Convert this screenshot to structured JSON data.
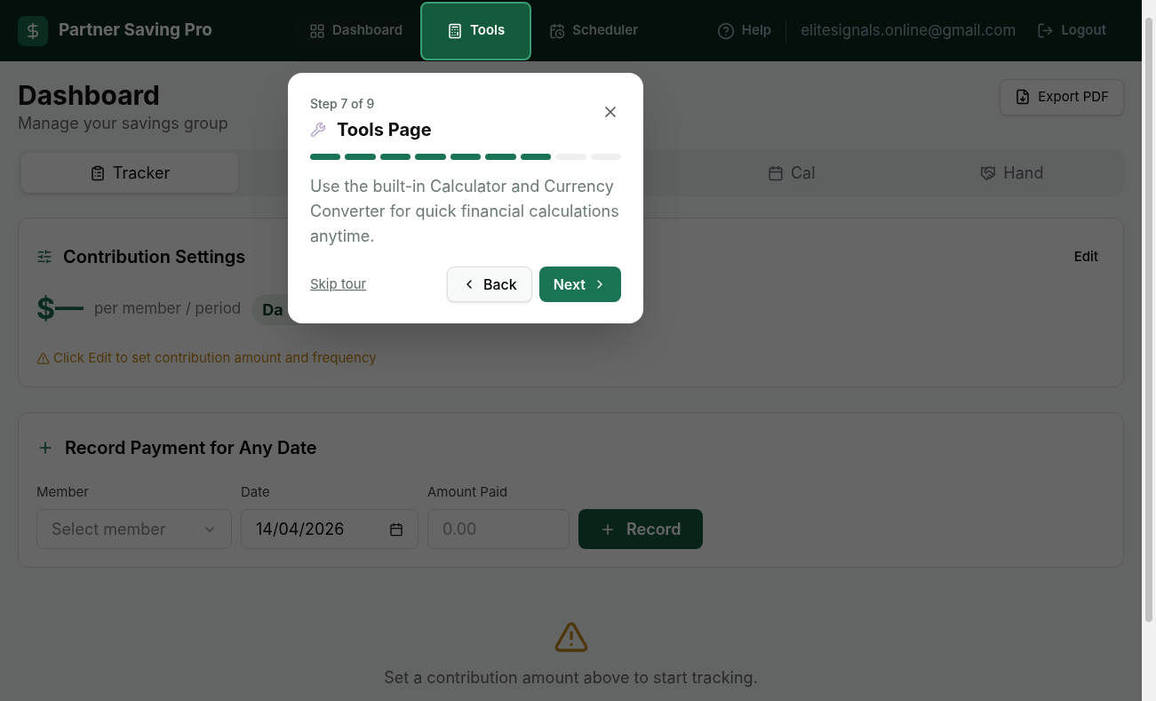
{
  "header": {
    "brand": "Partner Saving Pro",
    "nav": [
      {
        "label": "Dashboard",
        "selected": false
      },
      {
        "label": "Tools",
        "selected": true
      },
      {
        "label": "Scheduler",
        "selected": false
      }
    ],
    "help": "Help",
    "email": "elitesignals.online@gmail.com",
    "logout": "Logout"
  },
  "page": {
    "title": "Dashboard",
    "subtitle": "Manage your savings group",
    "export_button": "Export PDF"
  },
  "tabs": [
    {
      "label": "Tracker",
      "selected": true
    },
    {
      "label": "Cal",
      "selected": false
    },
    {
      "label": "Hand",
      "selected": false
    }
  ],
  "contribution": {
    "title": "Contribution Settings",
    "edit": "Edit",
    "amount": "$—",
    "per": "per member / period",
    "badge": "Da",
    "warning": "Click Edit to set contribution amount and frequency"
  },
  "record": {
    "title": "Record Payment for Any Date",
    "member": {
      "label": "Member",
      "placeholder": "Select member"
    },
    "date": {
      "label": "Date",
      "value": "14/04/2026"
    },
    "amount": {
      "label": "Amount Paid",
      "placeholder": "0.00"
    },
    "button": "Record"
  },
  "empty_state": "Set a contribution amount above to start tracking.",
  "tour": {
    "step": "Step 7 of 9",
    "title": "Tools Page",
    "steps": [
      {
        "done": true
      },
      {
        "done": true
      },
      {
        "done": true
      },
      {
        "done": true
      },
      {
        "done": true
      },
      {
        "done": true
      },
      {
        "done": true
      },
      {
        "done": false
      },
      {
        "done": false
      }
    ],
    "text": "Use the built-in Calculator and Currency Converter for quick financial calculations anytime.",
    "skip": "Skip tour",
    "back": "Back",
    "next": "Next"
  }
}
